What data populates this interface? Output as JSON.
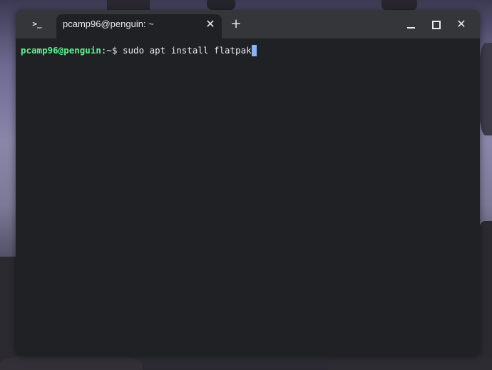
{
  "window": {
    "tab_title": "pcamp96@penguin: ~",
    "app_icon_glyph": ">_",
    "close_tab_glyph": "✕",
    "new_tab_glyph": "+",
    "close_window_glyph": "✕"
  },
  "terminal": {
    "prompt_user_host": "pcamp96@penguin",
    "prompt_path": ":~$ ",
    "command": "sudo apt install flatpak"
  },
  "colors": {
    "prompt_user": "#5ef090",
    "cursor": "#8ab4f8",
    "terminal_bg": "#202124",
    "title_bar_bg": "#35363a"
  }
}
